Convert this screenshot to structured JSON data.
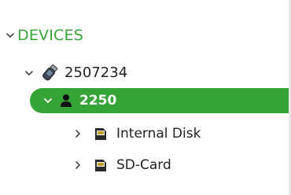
{
  "tree": {
    "root": {
      "label": "DEVICES",
      "expanded": true,
      "chevron_icon": "chevron-down-icon",
      "color": "#3aa33a"
    },
    "device": {
      "label": "2507234",
      "expanded": true,
      "icon": "usb-device-icon",
      "chevron_icon": "chevron-down-icon"
    },
    "user": {
      "label": "2250",
      "expanded": true,
      "selected": true,
      "icon": "user-icon",
      "chevron_icon": "chevron-down-icon",
      "highlight_color": "#36a336"
    },
    "storages": [
      {
        "label": "Internal Disk",
        "expanded": false,
        "icon": "sd-card-icon",
        "chevron_icon": "chevron-right-icon"
      },
      {
        "label": "SD-Card",
        "expanded": false,
        "icon": "sd-card-icon",
        "chevron_icon": "chevron-right-icon"
      }
    ]
  }
}
